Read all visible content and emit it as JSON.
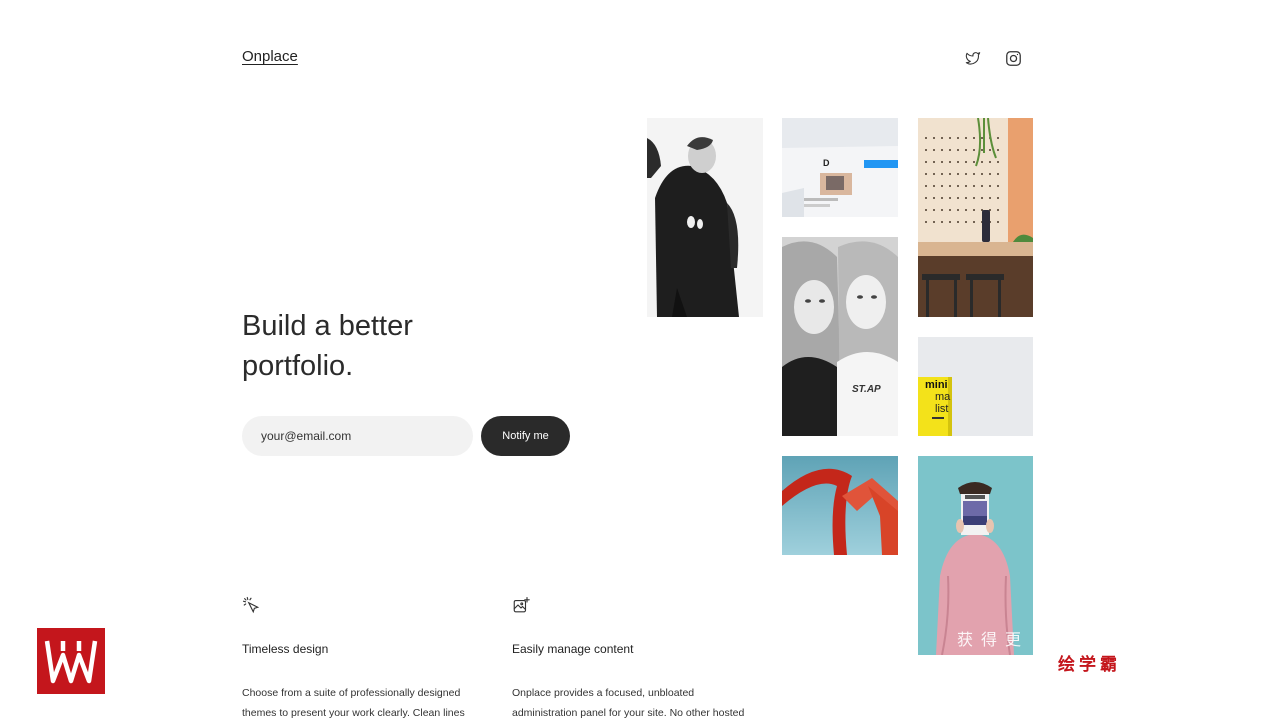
{
  "header": {
    "brand": "Onplace"
  },
  "social": [
    {
      "name": "twitter",
      "icon": "twitter-bird-icon"
    },
    {
      "name": "instagram",
      "icon": "instagram-icon"
    }
  ],
  "hero": {
    "headline_line1": "Build a better",
    "headline_line2": "portfolio.",
    "email_placeholder": "your@email.com",
    "notify_label": "Notify me"
  },
  "gallery": [
    {
      "label": "portrait-black-hoodie"
    },
    {
      "label": "web-design-mockup"
    },
    {
      "label": "interior-wooden-counter"
    },
    {
      "label": "two-women-portrait"
    },
    {
      "label": "minimalist-book"
    },
    {
      "label": "red-sculpture"
    },
    {
      "label": "woman-with-magazine"
    }
  ],
  "features": [
    {
      "icon": "cursor-click-icon",
      "title": "Timeless design",
      "desc_line1": "Choose from a suite of professionally designed",
      "desc_line2": "themes to present your work clearly. Clean lines"
    },
    {
      "icon": "add-image-icon",
      "title": "Easily manage content",
      "desc_line1": "Onplace provides a focused, unbloated",
      "desc_line2": "administration panel for your site. No other hosted"
    }
  ],
  "watermark": {
    "brand_text": "绘学霸",
    "overlay_text": "获得更"
  },
  "colors": {
    "accent_dark": "#2a2a2a",
    "input_bg": "#f2f2f2",
    "watermark_red": "#c4161c"
  }
}
